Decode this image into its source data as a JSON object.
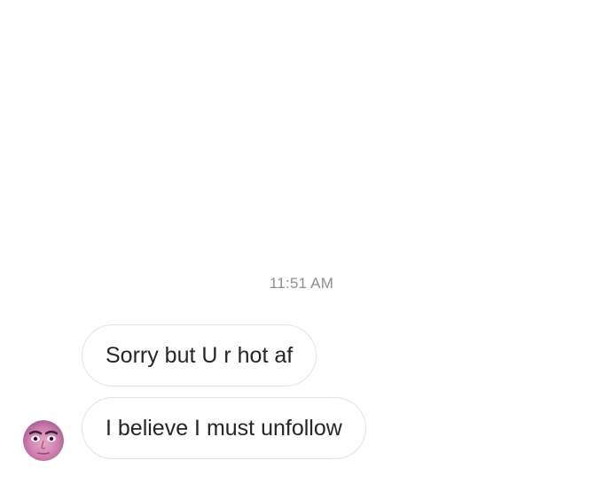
{
  "conversation": {
    "timestamp": "11:51 AM",
    "messages": [
      {
        "text": "Sorry but U r hot af"
      },
      {
        "text": "I believe I must unfollow"
      }
    ],
    "sender_avatar": {
      "icon": "user-avatar-photo"
    }
  },
  "colors": {
    "background": "#ffffff",
    "bubble_border": "#e3e3e3",
    "message_text": "#262626",
    "timestamp_text": "#8e8e8e"
  }
}
